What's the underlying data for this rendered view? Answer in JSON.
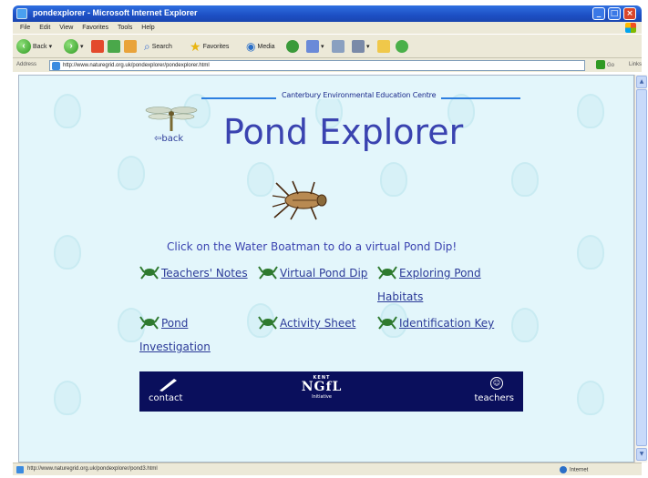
{
  "window": {
    "title": "pondexplorer - Microsoft Internet Explorer",
    "minimize": "_",
    "maximize": "□",
    "close": "×"
  },
  "menu": [
    "File",
    "Edit",
    "View",
    "Favorites",
    "Tools",
    "Help"
  ],
  "toolbar": {
    "back": "Back",
    "search": "Search",
    "favorites": "Favorites",
    "media": "Media"
  },
  "address": {
    "label": "Address",
    "url": "http://www.naturegrid.org.uk/pondexplorer/pondexplorer.html",
    "go": "Go",
    "links": "Links"
  },
  "page": {
    "centre_name": "Canterbury Environmental Education Centre",
    "title": "Pond Explorer",
    "back_label": "back",
    "instruction": "Click on the Water Boatman to do a virtual Pond Dip!",
    "links": [
      {
        "label": "Teachers' Notes"
      },
      {
        "label": "Virtual Pond Dip"
      },
      {
        "label": "Exploring Pond Habitats"
      },
      {
        "label": "Pond Investigation"
      },
      {
        "label": "Activity Sheet"
      },
      {
        "label": "Identification Key"
      }
    ],
    "banner": {
      "contact": "contact",
      "kent": "KENT",
      "ngfl": "NGfL",
      "initiative": "Initiative",
      "teachers": "teachers"
    }
  },
  "status": {
    "text": "http://www.naturegrid.org.uk/pondexplorer/pond3.html",
    "zone": "Internet"
  },
  "colors": {
    "page_bg": "#e3f6fb",
    "title": "#3a43b0",
    "link": "#2b3a98",
    "banner": "#0a0f5c"
  }
}
